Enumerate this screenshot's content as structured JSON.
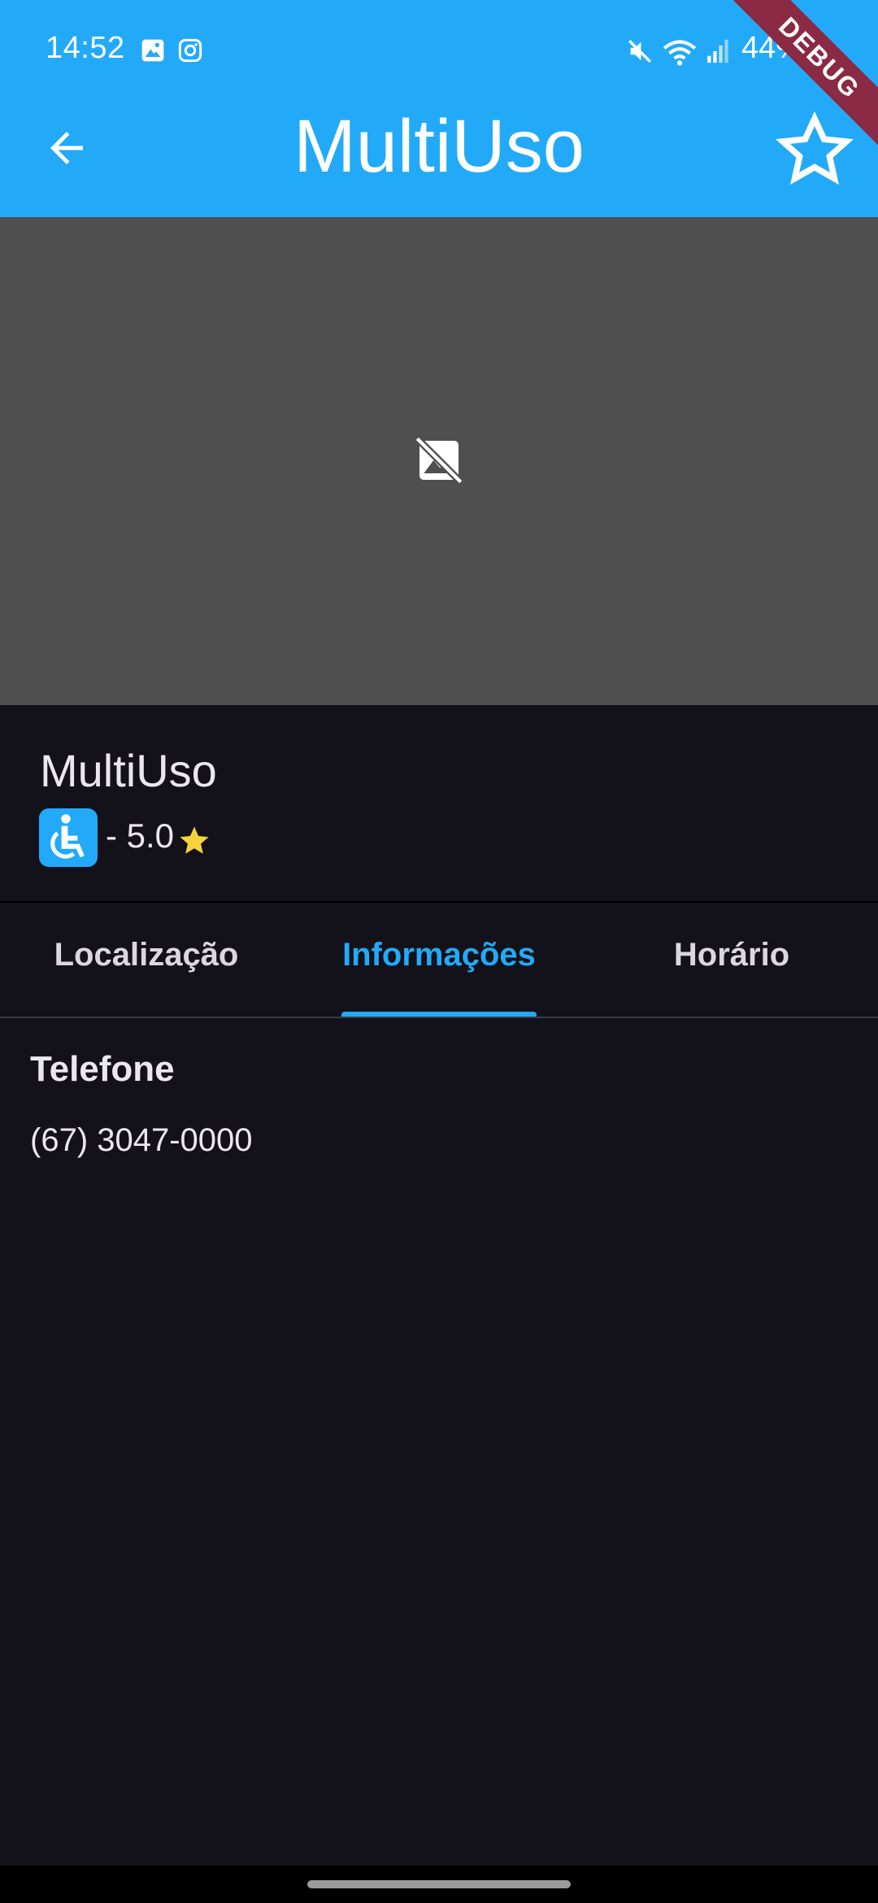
{
  "status_bar": {
    "time": "14:52",
    "battery": "44%"
  },
  "appbar": {
    "title": "MultiUso",
    "debug_banner": "DEBUG"
  },
  "place": {
    "name": "MultiUso",
    "rating": "- 5.0"
  },
  "tabs": [
    {
      "label": "Localização",
      "active": false
    },
    {
      "label": "Informações",
      "active": true
    },
    {
      "label": "Horário",
      "active": false
    }
  ],
  "details": {
    "phone_label": "Telefone",
    "phone_value": "(67) 3047-0000"
  },
  "colors": {
    "accent": "#22aaf8",
    "background": "#13121a",
    "image_placeholder": "#4f4f4f",
    "star": "#f6d33a"
  }
}
